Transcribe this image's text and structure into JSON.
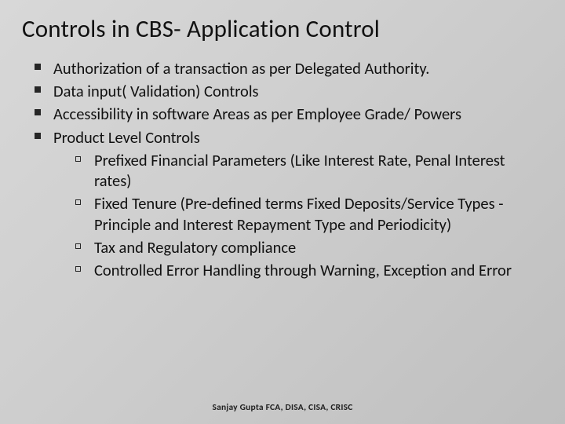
{
  "title": "Controls in CBS- Application Control",
  "bullets": [
    {
      "text": "Authorization of a transaction as per Delegated Authority."
    },
    {
      "text": " Data input( Validation) Controls"
    },
    {
      "text": "Accessibility in software Areas as per Employee Grade/ Powers"
    },
    {
      "text": "Product Level Controls",
      "sub": [
        "Prefixed Financial Parameters (Like Interest Rate, Penal Interest rates)",
        "Fixed Tenure (Pre-defined terms Fixed Deposits/Service Types - Principle and Interest Repayment Type and Periodicity)",
        "Tax and Regulatory compliance",
        "Controlled Error Handling through Warning, Exception and Error"
      ]
    }
  ],
  "footer": "Sanjay Gupta   FCA, DISA, CISA, CRISC"
}
